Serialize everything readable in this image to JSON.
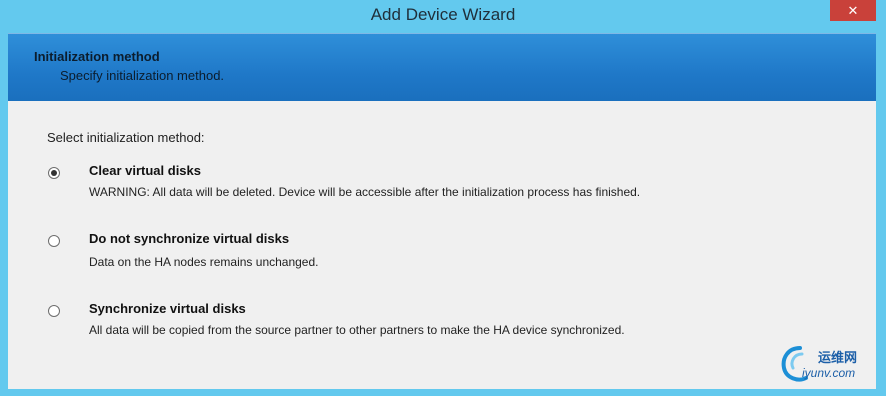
{
  "window": {
    "title": "Add Device Wizard",
    "close_glyph": "✕"
  },
  "header": {
    "title": "Initialization method",
    "subtitle": "Specify initialization method."
  },
  "content": {
    "prompt": "Select initialization method:",
    "options": [
      {
        "title": "Clear virtual disks",
        "description": "WARNING: All data will be deleted. Device will be accessible after the initialization process has finished.",
        "selected": true
      },
      {
        "title": "Do not synchronize virtual disks",
        "description": "Data on the HA nodes remains unchanged.",
        "selected": false
      },
      {
        "title": "Synchronize virtual disks",
        "description": "All data will be copied from the source partner to other partners to make the HA device synchronized.",
        "selected": false
      }
    ]
  },
  "watermark": {
    "top_text": "运维网",
    "bottom_text": "iyunv.com"
  },
  "colors": {
    "titlebar": "#63c9ee",
    "header_blue": "#1f78c8",
    "content_bg": "#f0f0f0",
    "close_red": "#c9413a"
  }
}
